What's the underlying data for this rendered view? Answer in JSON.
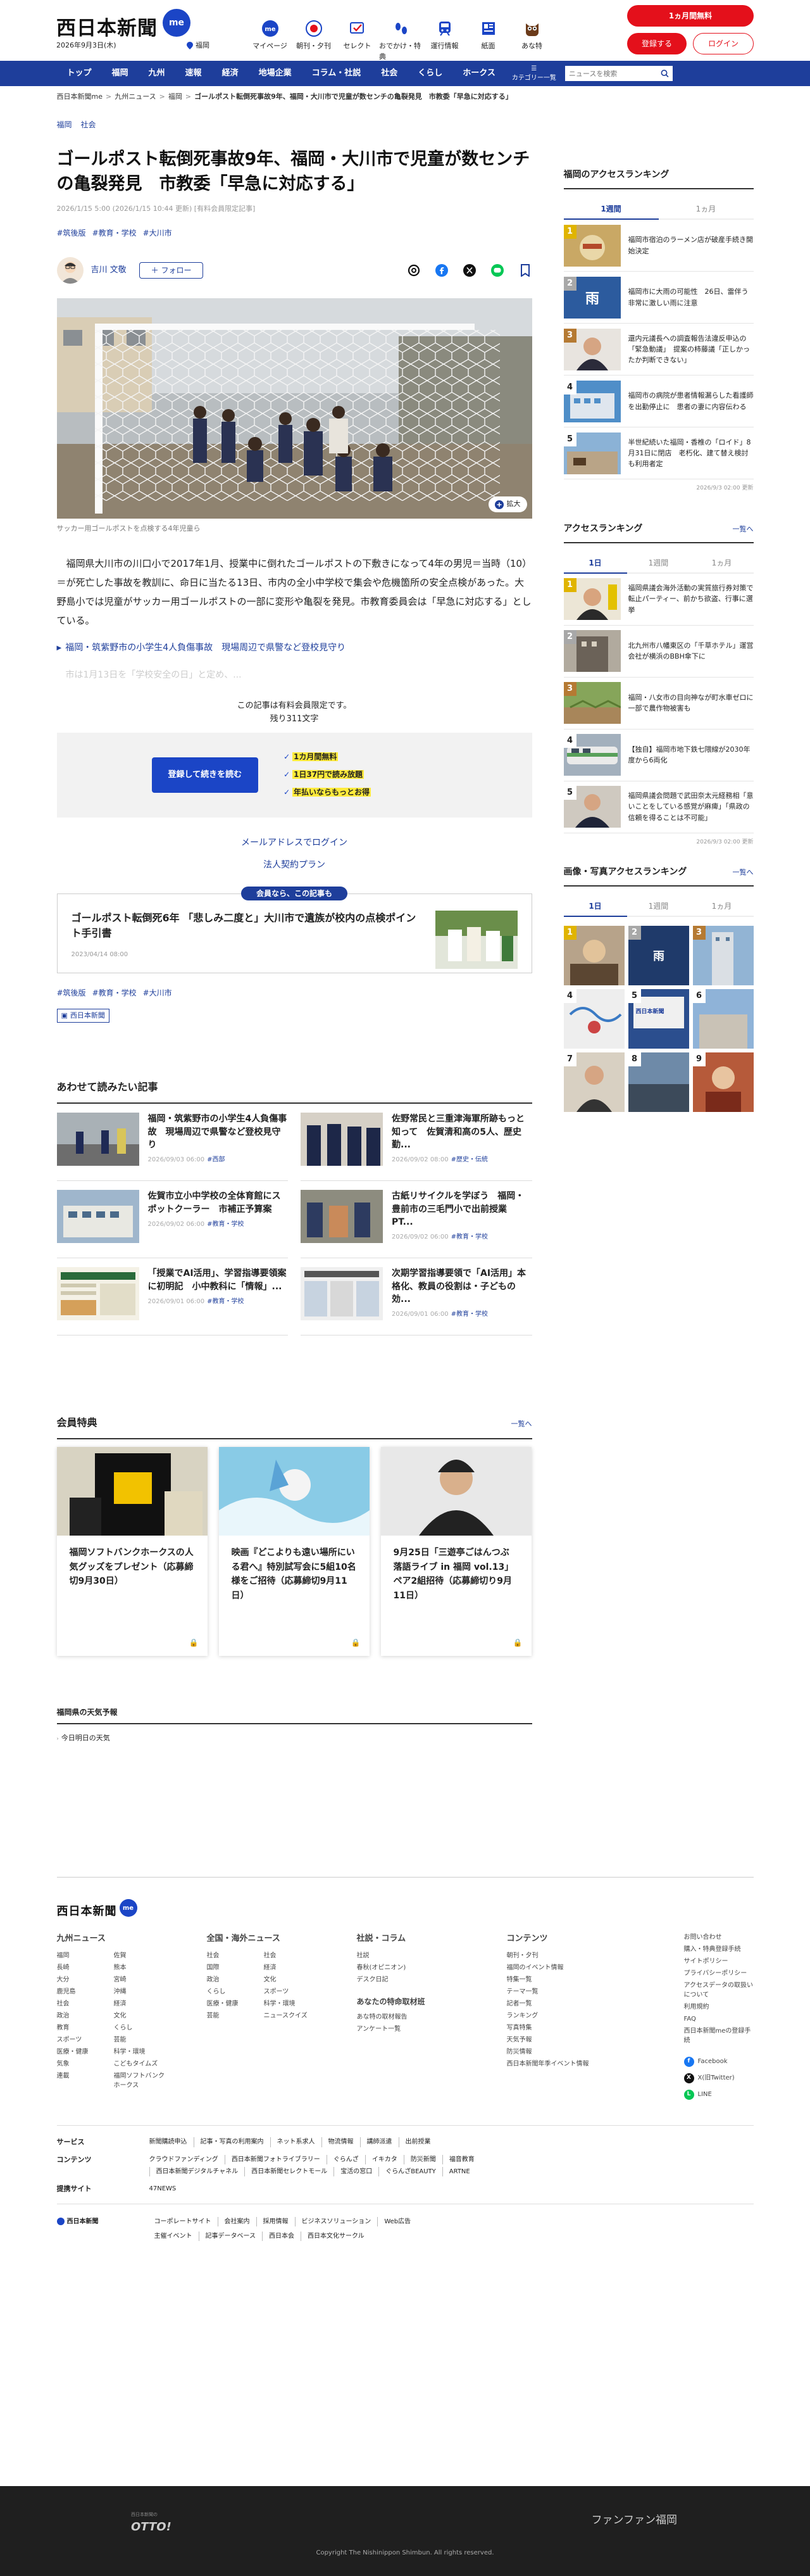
{
  "header": {
    "logo": "西日本新聞",
    "logo_badge": "me",
    "date": "2026年9月3日(木)",
    "location": "福岡",
    "nav": [
      {
        "label": "マイページ",
        "icon": "me-icon"
      },
      {
        "label": "朝刊・夕刊",
        "icon": "newspaper-icon"
      },
      {
        "label": "セレクト",
        "icon": "select-icon"
      },
      {
        "label": "おでかけ・特典",
        "icon": "footprints-icon"
      },
      {
        "label": "運行情報",
        "icon": "train-icon"
      },
      {
        "label": "紙面",
        "icon": "paper-icon"
      },
      {
        "label": "あな特",
        "icon": "owl-icon"
      }
    ],
    "free_trial": "1ヵ月間無料",
    "register": "登録する",
    "login": "ログイン"
  },
  "navbar": {
    "items": [
      "トップ",
      "福岡",
      "九州",
      "速報",
      "経済",
      "地場企業",
      "コラム・社説",
      "社会",
      "くらし",
      "ホークス"
    ],
    "category": "カテゴリー一覧",
    "search_placeholder": "ニュースを検索"
  },
  "breadcrumb": [
    "西日本新聞me",
    "九州ニュース",
    "福岡",
    "ゴールポスト転倒死事故9年、福岡・大川市で児童が数センチの亀裂発見　市教委「早急に対応する」"
  ],
  "article": {
    "tags": [
      "福岡",
      "社会"
    ],
    "title": "ゴールポスト転倒死事故9年、福岡・大川市で児童が数センチの亀裂発見　市教委「早急に対応する」",
    "meta": "2026/1/15 5:00 (2026/1/15 10:44 更新) [有料会員限定記事]",
    "keywords": [
      "#筑後版",
      "#教育・学校",
      "#大川市"
    ],
    "author": "吉川 文敬",
    "follow": "＋ フォロー",
    "zoom": "拡大",
    "caption": "サッカー用ゴールポストを点検する4年児童ら",
    "body": "福岡県大川市の川口小で2017年1月、授業中に倒れたゴールポストの下敷きになって4年の男児＝当時（10）＝が死亡した事故を教訓に、命日に当たる13日、市内の全小中学校で集会や危機箇所の安全点検があった。大野島小では児童がサッカー用ゴールポストの一部に変形や亀裂を発見。市教育委員会は「早急に対応する」としている。",
    "related_link": "福岡・筑紫野市の小学生4人負傷事故　現場周辺で県警など登校見守り",
    "faded": "市は1月13日を「学校安全の日」と定め、..."
  },
  "paywall": {
    "note1": "この記事は有料会員限定です。",
    "note2": "残り311文字",
    "register_btn": "登録して続きを読む",
    "merit1": "1カ月間無料",
    "merit2": "1日37円で読み放題",
    "merit3": "年払いならもっとお得",
    "email_login": "メールアドレスでログイン",
    "corporate": "法人契約プラン"
  },
  "member_article": {
    "tag": "会員なら、この記事も",
    "title": "ゴールポスト転倒死6年 「悲しみ二度と」大川市で遺族が校内の点検ポイント手引書",
    "date": "2023/04/14 08:00"
  },
  "article_footer": {
    "keywords": [
      "#筑後版",
      "#教育・学校",
      "#大川市"
    ],
    "publisher": "西日本新聞"
  },
  "related": {
    "heading": "あわせて読みたい記事",
    "items": [
      {
        "title": "福岡・筑紫野市の小学生4人負傷事故　現場周辺で県警など登校見守り",
        "date": "2026/09/03 06:00",
        "tag": "#西部"
      },
      {
        "title": "佐野常民と三重津海軍所跡もっと知って　佐賀清和高の5人、歴史勤...",
        "date": "2026/09/02 08:00",
        "tag": "#歴史・伝統"
      },
      {
        "title": "佐賀市立小中学校の全体育館にスポットクーラー　市補正予算案",
        "date": "2026/09/02 06:00",
        "tag": "#教育・学校"
      },
      {
        "title": "古紙リサイクルを学ぼう　福岡・豊前市の三毛門小で出前授業　PT...",
        "date": "2026/09/02 06:00",
        "tag": "#教育・学校"
      },
      {
        "title": "「授業でAI活用」、学習指導要領案に初明記　小中教科に「情報」...",
        "date": "2026/09/01 06:00",
        "tag": "#教育・学校"
      },
      {
        "title": "次期学習指導要領で「AI活用」本格化、教員の役割は・子どもの効...",
        "date": "2026/09/01 06:00",
        "tag": "#教育・学校"
      }
    ]
  },
  "benefits": {
    "heading": "会員特典",
    "more": "一覧へ",
    "items": [
      {
        "title": "福岡ソフトバンクホークスの人気グッズをプレゼント（応募締切9月30日）"
      },
      {
        "title": "映画『どこよりも遠い場所にいる君へ』特別試写会に5組10名様をご招待（応募締切9月11日）"
      },
      {
        "title": "9月25日「三遊亭ごはんつぶ 落語ライブ in 福岡 vol.13」ペア2組招待（応募締切り9月11日）"
      }
    ]
  },
  "weather": {
    "heading": "福岡県の天気予報",
    "tab": "今日明日の天気"
  },
  "sidebar": {
    "ranking1": {
      "heading": "福岡のアクセスランキング",
      "tabs": [
        "1週間",
        "1ヵ月"
      ],
      "items": [
        "福岡市宿泊のラーメン店が破産手続き開始決定",
        "福岡市に大雨の可能性　26日、雷伴う非常に激しい雨に注意",
        "還内元議長への調査報告法違反申込の「緊急動議」　提案の柿藤議「正しかったか判断できない」",
        "福岡市の病院が患者情報漏らした看護師を出勤停止に　患者の妻に内容伝わる",
        "半世紀続いた福岡・香椎の「ロイド」8月31日に閉店　老朽化、建て替え検討も利用者定"
      ],
      "updated": "2026/9/3 02:00 更新"
    },
    "ranking2": {
      "heading": "アクセスランキング",
      "more": "一覧へ",
      "tabs": [
        "1日",
        "1週間",
        "1ヵ月"
      ],
      "items": [
        "福岡県議会海外活動の実質旅行券対策で転止パーティー、前かち欲盗、行事に選挙",
        "北九州市八幡東区の「千草ホテル」運営会社が横浜のBBH傘下に",
        "福岡・八女市の目向神なが町水車ゼロに　一部で農作物被害も",
        "【独自】福岡市地下鉄七隈線が2030年度から6両化",
        "福岡県議会問題で武田奈太元経務相「意いことをしている感覚が麻痺」「県政の信頼を得ることは不可能」"
      ],
      "updated": "2026/9/3 02:00 更新"
    },
    "photo_ranking": {
      "heading": "画像・写真アクセスランキング",
      "more": "一覧へ",
      "tabs": [
        "1日",
        "1週間",
        "1ヵ月"
      ],
      "ranks": [
        "1",
        "2",
        "3",
        "4",
        "5",
        "6",
        "7",
        "8",
        "9"
      ],
      "labels": [
        "",
        "",
        "",
        "",
        "西日本新聞",
        "",
        "",
        "",
        ""
      ]
    }
  },
  "footer": {
    "logo": "西日本新聞",
    "logo_badge": "me",
    "cols": [
      {
        "heading": "九州ニュース",
        "items": [
          "福岡",
          "佐賀",
          "長崎",
          "熊本",
          "大分",
          "宮崎",
          "鹿児島",
          "沖縄",
          "社会",
          "経済",
          "政治",
          "文化",
          "教育",
          "くらし",
          "スポーツ",
          "芸能",
          "医療・健康",
          "科学・環境",
          "気象",
          "こどもタイムズ",
          "連載",
          "福岡ソフトバンクホークス"
        ]
      },
      {
        "heading": "全国・海外ニュース",
        "items": [
          "社会",
          "社会",
          "国際",
          "経済",
          "政治",
          "文化",
          "くらし",
          "スポーツ",
          "医療・健康",
          "科学・環境",
          "芸能",
          "ニュースクイズ"
        ]
      },
      {
        "heading": "社説・コラム",
        "items": [
          "社説",
          "春秋(オピニオン)",
          "デスク日記"
        ],
        "sub_heading": "あなたの特命取材班",
        "sub_items": [
          "あな特の取材報告",
          "アンケート一覧"
        ]
      },
      {
        "heading": "コンテンツ",
        "items": [
          "朝刊・夕刊",
          "福岡のイベント情報",
          "特集一覧",
          "テーマ一覧",
          "記者一覧",
          "ランキング",
          "写真特集",
          "天気予報",
          "防災情報",
          "西日本新聞年季イベント情報"
        ]
      }
    ],
    "side_links": [
      "お問い合わせ",
      "購入・特典登録手続",
      "サイトポリシー",
      "プライバシーポリシー",
      "アクセスデータの取扱いについて",
      "利用規約",
      "FAQ",
      "西日本新聞meの登録手続"
    ],
    "sns": [
      "Facebook",
      "X(旧Twitter)",
      "LINE"
    ],
    "rows": [
      {
        "label": "サービス",
        "links": [
          "新聞購読申込",
          "記事・写真の利用案内",
          "ネット系求人",
          "物流情報",
          "講師派遣",
          "出前授業"
        ]
      },
      {
        "label": "コンテンツ",
        "links": [
          "クラウドファンディング",
          "西日本新聞フォトライブラリー",
          "ぐらんざ",
          "イキカタ",
          "防災新聞",
          "福音教育",
          "西日本新聞デジタルチャネル",
          "西日本新聞セレクトモール",
          "宝活の窓口",
          "ぐらんざBEAUTY",
          "ARTNE"
        ]
      },
      {
        "label": "提携サイト",
        "links": [
          "47NEWS"
        ]
      }
    ],
    "corp_logo": "西日本新聞",
    "corp_links": [
      "コーポレートサイト",
      "会社案内",
      "採用情報",
      "ビジネスソリューション",
      "Web広告",
      "主催イベント",
      "記事データベース",
      "西日本会",
      "西日本文化サークル"
    ],
    "otto": "OTTO!",
    "otto_sub": "西日本新聞の",
    "fanfan": "ファンファン福岡",
    "copyright": "Copyright The Nishinippon Shimbun. All rights reserved."
  },
  "colors": {
    "brand": "#1e3e9b",
    "accent": "#e4101b",
    "highlight": "#ffeb3b"
  }
}
